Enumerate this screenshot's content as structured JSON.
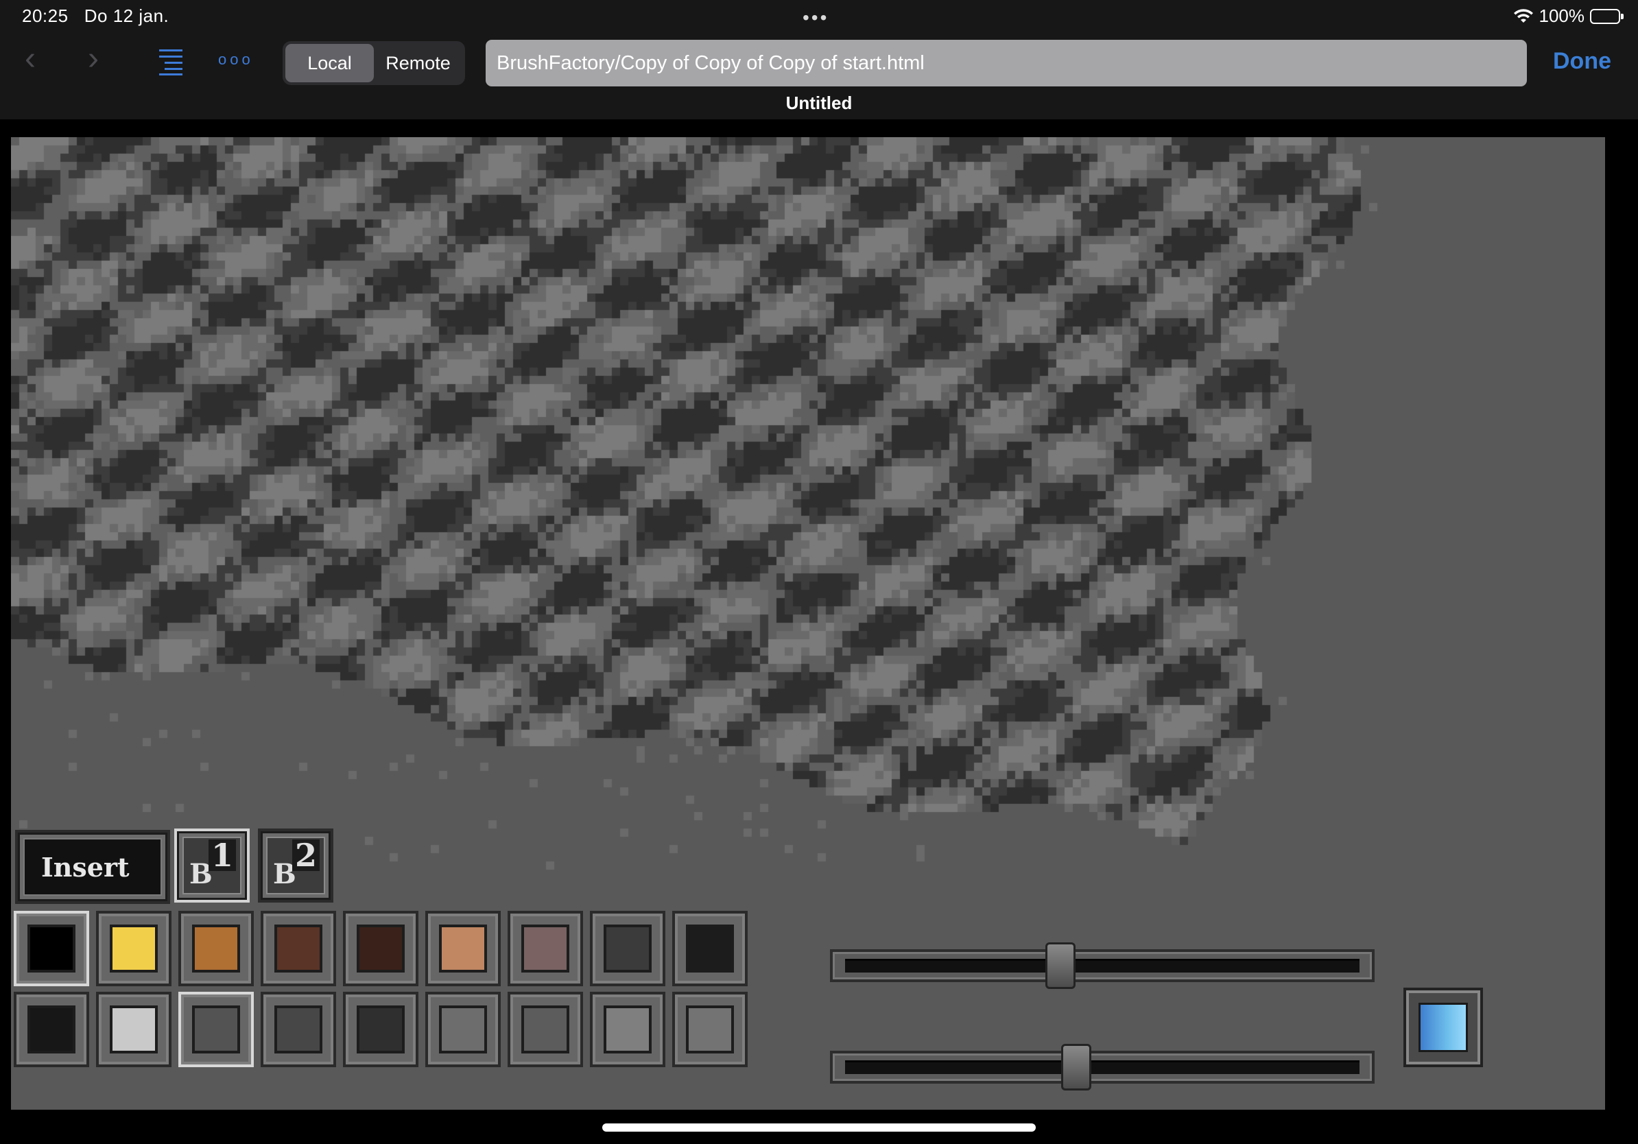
{
  "status_bar": {
    "time": "20:25",
    "date": "Do 12 jan.",
    "center_dots": "•••",
    "battery_percent": "100%",
    "wifi_icon": "wifi-icon",
    "battery_icon": "battery-charging-icon"
  },
  "toolbar": {
    "back_icon": "‹",
    "forward_icon": "›",
    "more_icon": "ooo",
    "segments": [
      "Local",
      "Remote"
    ],
    "active_segment": "Local",
    "url": "BrushFactory/Copy of Copy of Copy of start.html",
    "done_label": "Done",
    "document_title": "Untitled",
    "accent_color": "#3b7fd6"
  },
  "app": {
    "insert_label": "Insert",
    "brushes": [
      {
        "letter": "B",
        "number": "1",
        "selected": true
      },
      {
        "letter": "B",
        "number": "2",
        "selected": false
      }
    ],
    "palette_row1": [
      "#000000",
      "#f2cf4b",
      "#b06f33",
      "#5a3426",
      "#3a2119",
      "#c08762",
      "#7a6262",
      "#3b3b3b",
      "#1c1c1c"
    ],
    "palette_row2": [
      "#171717",
      "#c9c9c9",
      "#535353",
      "#474747",
      "#2f2f2f",
      "#6d6d6d",
      "#5c5c5c",
      "#7f7f7f",
      "#737373"
    ],
    "selected_swatches": [
      "row1-0",
      "row2-2"
    ],
    "slider_1_value": 0.42,
    "slider_2_value": 0.45,
    "current_color": "#6ebfec",
    "canvas_background": "#595959"
  }
}
